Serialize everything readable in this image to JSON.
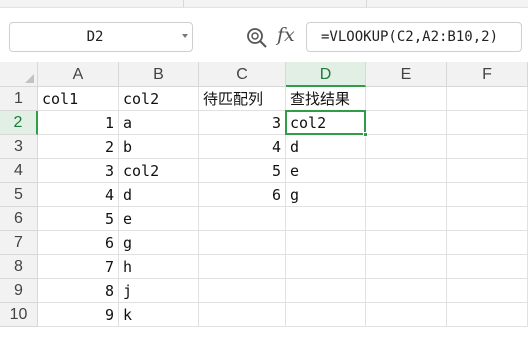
{
  "name_box": {
    "value": "D2"
  },
  "formula_bar": {
    "fx_label": "fx",
    "formula": "=VLOOKUP(C2,A2:B10,2)"
  },
  "columns": [
    "A",
    "B",
    "C",
    "D",
    "E",
    "F"
  ],
  "rows": [
    "1",
    "2",
    "3",
    "4",
    "5",
    "6",
    "7",
    "8",
    "9",
    "10"
  ],
  "active_cell": {
    "column": "D",
    "row": "2"
  },
  "cells": {
    "A1": "col1",
    "B1": "col2",
    "C1": "待匹配列",
    "D1": "查找结果",
    "A2": "1",
    "B2": "a",
    "C2": "3",
    "D2": "col2",
    "A3": "2",
    "B3": "b",
    "C3": "4",
    "D3": "d",
    "A4": "3",
    "B4": "col2",
    "C4": "5",
    "D4": "e",
    "A5": "4",
    "B5": "d",
    "C5": "6",
    "D5": "g",
    "A6": "5",
    "B6": "e",
    "A7": "6",
    "B7": "g",
    "A8": "7",
    "B8": "h",
    "A9": "8",
    "B9": "j",
    "A10": "9",
    "B10": "k"
  },
  "colors": {
    "accent": "#2e9e4b",
    "header_bg": "#f2f2f2",
    "grid_line": "#e1e1e1"
  }
}
